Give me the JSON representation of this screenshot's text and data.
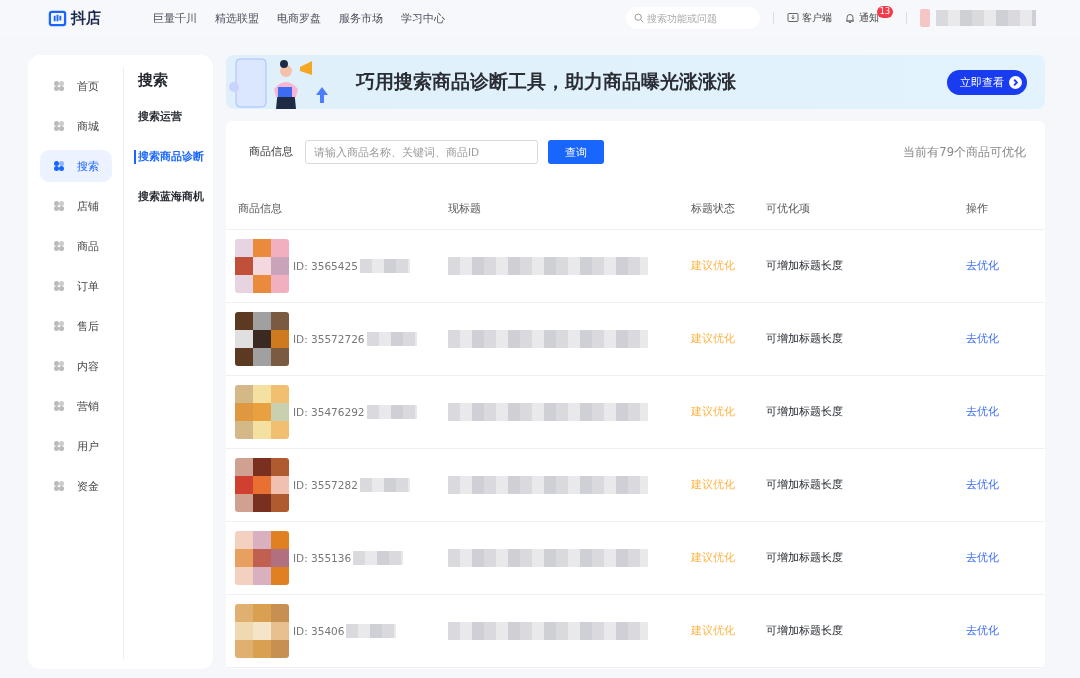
{
  "topbar": {
    "logo": "抖店",
    "nav": [
      "巨量千川",
      "精选联盟",
      "电商罗盘",
      "服务市场",
      "学习中心"
    ],
    "search": {
      "placeholder": "搜索功能或问题"
    },
    "client": "客户端",
    "notice": {
      "label": "通知",
      "badge": "13"
    }
  },
  "sidebar": {
    "items": [
      {
        "label": "首页",
        "selected": false
      },
      {
        "label": "商城",
        "selected": false
      },
      {
        "label": "搜索",
        "selected": true
      },
      {
        "label": "店铺",
        "selected": false
      },
      {
        "label": "商品",
        "selected": false
      },
      {
        "label": "订单",
        "selected": false
      },
      {
        "label": "售后",
        "selected": false
      },
      {
        "label": "内容",
        "selected": false
      },
      {
        "label": "营销",
        "selected": false
      },
      {
        "label": "用户",
        "selected": false
      },
      {
        "label": "资金",
        "selected": false
      }
    ]
  },
  "subnav": {
    "title": "搜索",
    "items": [
      {
        "label": "搜索运营",
        "selected": false
      },
      {
        "label": "搜索商品诊断",
        "selected": true
      },
      {
        "label": "搜索蓝海商机",
        "selected": false
      }
    ]
  },
  "banner": {
    "headline": "巧用搜索商品诊断工具，助力商品曝光涨涨涨",
    "button": "立即查看"
  },
  "filter": {
    "label": "商品信息",
    "input": {
      "placeholder": "请输入商品名称、关键词、商品ID"
    },
    "button": "查询",
    "summary": "当前有79个商品可优化"
  },
  "table": {
    "columns": [
      "商品信息",
      "现标题",
      "标题状态",
      "可优化项",
      "操作"
    ],
    "rows": [
      {
        "id": "ID: 3565425",
        "status": "建议优化",
        "item": "可增加标题长度",
        "action": "去优化"
      },
      {
        "id": "ID: 35572726",
        "status": "建议优化",
        "item": "可增加标题长度",
        "action": "去优化"
      },
      {
        "id": "ID: 35476292",
        "status": "建议优化",
        "item": "可增加标题长度",
        "action": "去优化"
      },
      {
        "id": "ID: 3557282",
        "status": "建议优化",
        "item": "可增加标题长度",
        "action": "去优化"
      },
      {
        "id": "ID: 355136",
        "status": "建议优化",
        "item": "可增加标题长度",
        "action": "去优化"
      },
      {
        "id": "ID: 35406",
        "status": "建议优化",
        "item": "可增加标题长度",
        "action": "去优化"
      }
    ]
  }
}
